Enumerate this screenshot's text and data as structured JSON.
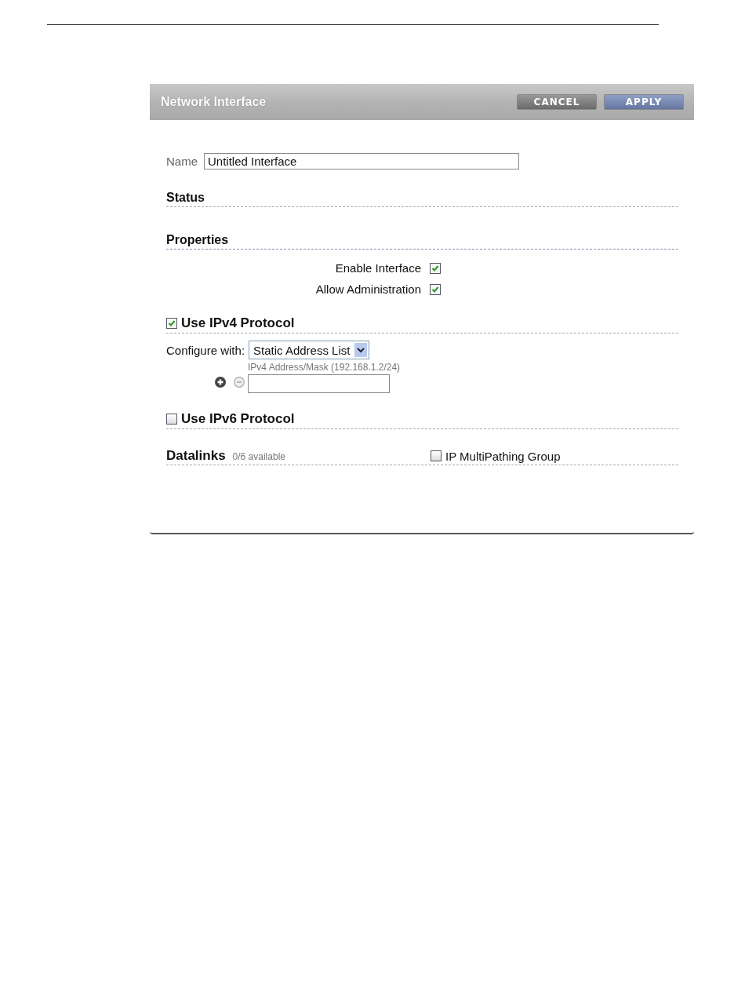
{
  "window": {
    "title": "Network Interface"
  },
  "buttons": [
    {
      "label": "CANCEL",
      "kind": "cancel"
    },
    {
      "label": "APPLY",
      "kind": "apply"
    }
  ],
  "name_field": {
    "label": "Name",
    "value": "Untitled Interface"
  },
  "status": {
    "heading": "Status"
  },
  "properties": {
    "heading": "Properties",
    "options": [
      {
        "label": "Enable Interface",
        "checked": true
      },
      {
        "label": "Allow Administration",
        "checked": true
      }
    ]
  },
  "ipv4": {
    "label": "Use IPv4 Protocol",
    "checked": true,
    "configure_label": "Configure with:",
    "configure_value": "Static Address List",
    "address_label": "IPv4 Address/Mask (192.168.1.2/24)"
  },
  "ipv6": {
    "label": "Use IPv6 Protocol",
    "checked": false
  },
  "datalinks": {
    "heading": "Datalinks",
    "count": "0/6 available",
    "ipmp": {
      "label": "IP MultiPathing Group",
      "checked": false
    }
  }
}
